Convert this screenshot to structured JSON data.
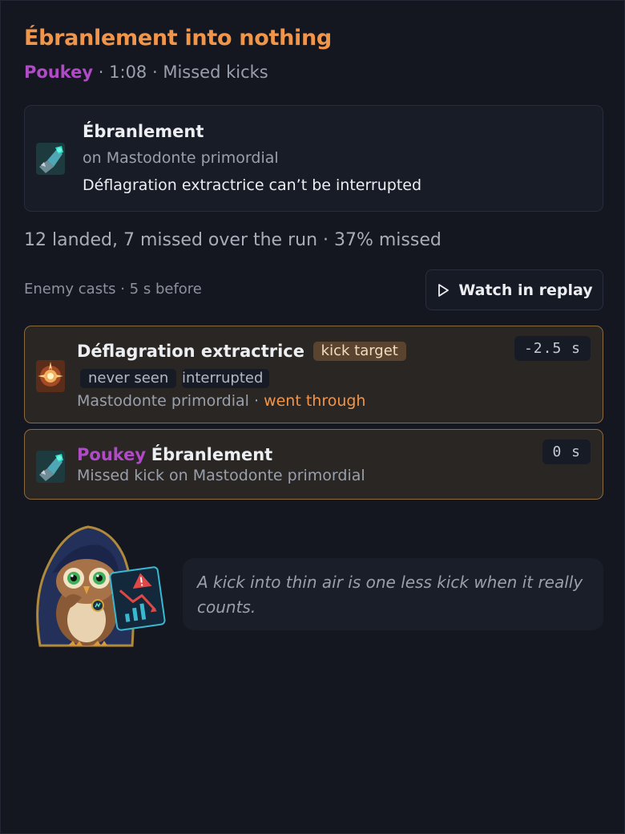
{
  "header": {
    "title": "Ébranlement into nothing",
    "player": "Poukey",
    "meta": " · 1:08 · Missed kicks"
  },
  "spell": {
    "name": "Ébranlement",
    "target": "on Mastodonte primordial",
    "note": "Déflagration extractrice can’t be interrupted",
    "icon": "gauntlet-spell-icon"
  },
  "stats": "12 landed, 7 missed over the run · 37% missed",
  "timeline": {
    "label": "Enemy casts · 5 s before",
    "replay_label": "Watch in replay"
  },
  "events": [
    {
      "name": "Déflagration extractrice",
      "tags": [
        "kick target",
        "never seen",
        "interrupted"
      ],
      "source": "Mastodonte primordial",
      "separator": " · ",
      "outcome": "went through",
      "time": "-2.5 s",
      "icon": "explosion-spell-icon"
    },
    {
      "player": "Poukey",
      "name": "Ébranlement",
      "detail": "Missed kick on Mastodonte primordial",
      "time": "0 s",
      "icon": "gauntlet-spell-icon"
    }
  ],
  "mascot": {
    "icon": "owl-mascot-icon",
    "quote": "A kick into thin air is one less kick when it really counts."
  },
  "colors": {
    "accent_orange": "#f0954a",
    "player_purple": "#b04ac6",
    "background": "#141720",
    "event_border": "#8a6a3e"
  }
}
